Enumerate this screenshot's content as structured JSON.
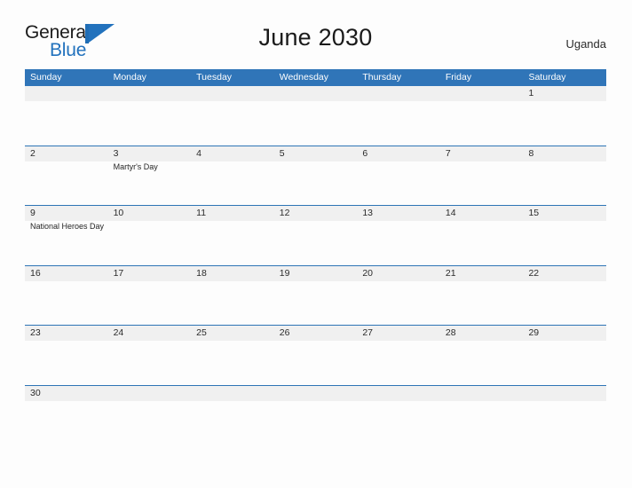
{
  "brand": {
    "word_one": "General",
    "word_two": "Blue",
    "flag_icon": "flag-triangle-icon"
  },
  "header": {
    "title": "June 2030",
    "region": "Uganda"
  },
  "theme": {
    "header_blue": "#3075b8",
    "rule_blue": "#2e75b6",
    "band_gray": "#f0f0f0",
    "page_background": "#fdfdfd",
    "brand_blue": "#2272bd",
    "text_dark": "#1a1a1a"
  },
  "calendar": {
    "weekdays": [
      "Sunday",
      "Monday",
      "Tuesday",
      "Wednesday",
      "Thursday",
      "Friday",
      "Saturday"
    ],
    "weeks": [
      {
        "size": "standard",
        "days": [
          {
            "number": "",
            "events": []
          },
          {
            "number": "",
            "events": []
          },
          {
            "number": "",
            "events": []
          },
          {
            "number": "",
            "events": []
          },
          {
            "number": "",
            "events": []
          },
          {
            "number": "",
            "events": []
          },
          {
            "number": "1",
            "events": []
          }
        ]
      },
      {
        "size": "standard",
        "days": [
          {
            "number": "2",
            "events": []
          },
          {
            "number": "3",
            "events": [
              "Martyr's Day"
            ]
          },
          {
            "number": "4",
            "events": []
          },
          {
            "number": "5",
            "events": []
          },
          {
            "number": "6",
            "events": []
          },
          {
            "number": "7",
            "events": []
          },
          {
            "number": "8",
            "events": []
          }
        ]
      },
      {
        "size": "standard",
        "days": [
          {
            "number": "9",
            "events": [
              "National Heroes Day"
            ]
          },
          {
            "number": "10",
            "events": []
          },
          {
            "number": "11",
            "events": []
          },
          {
            "number": "12",
            "events": []
          },
          {
            "number": "13",
            "events": []
          },
          {
            "number": "14",
            "events": []
          },
          {
            "number": "15",
            "events": []
          }
        ]
      },
      {
        "size": "standard",
        "days": [
          {
            "number": "16",
            "events": []
          },
          {
            "number": "17",
            "events": []
          },
          {
            "number": "18",
            "events": []
          },
          {
            "number": "19",
            "events": []
          },
          {
            "number": "20",
            "events": []
          },
          {
            "number": "21",
            "events": []
          },
          {
            "number": "22",
            "events": []
          }
        ]
      },
      {
        "size": "standard",
        "days": [
          {
            "number": "23",
            "events": []
          },
          {
            "number": "24",
            "events": []
          },
          {
            "number": "25",
            "events": []
          },
          {
            "number": "26",
            "events": []
          },
          {
            "number": "27",
            "events": []
          },
          {
            "number": "28",
            "events": []
          },
          {
            "number": "29",
            "events": []
          }
        ]
      },
      {
        "size": "short",
        "days": [
          {
            "number": "30",
            "events": []
          },
          {
            "number": "",
            "events": []
          },
          {
            "number": "",
            "events": []
          },
          {
            "number": "",
            "events": []
          },
          {
            "number": "",
            "events": []
          },
          {
            "number": "",
            "events": []
          },
          {
            "number": "",
            "events": []
          }
        ]
      }
    ]
  }
}
